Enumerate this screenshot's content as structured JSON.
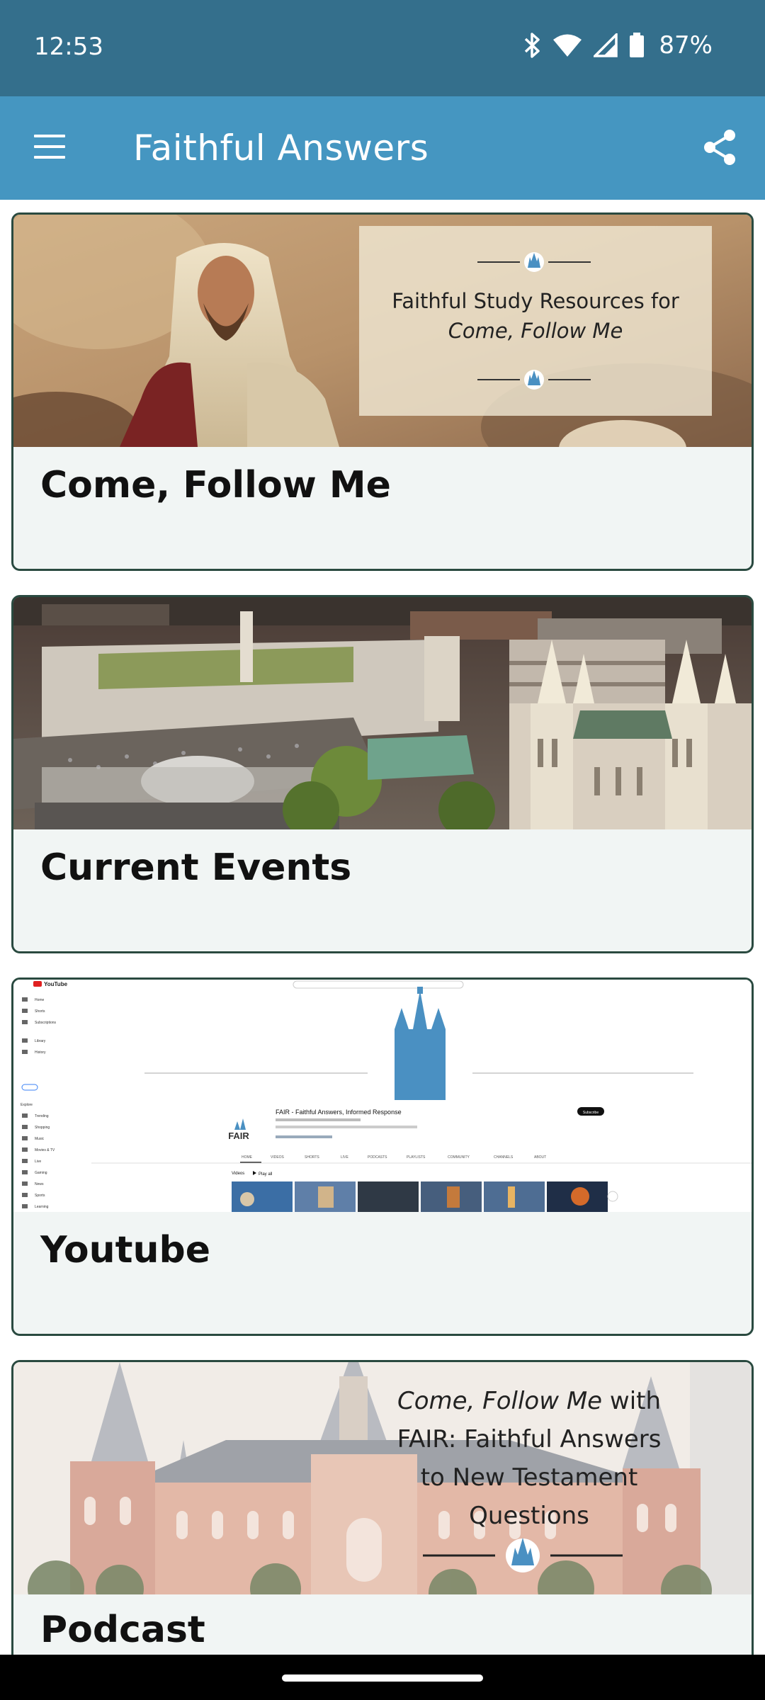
{
  "status_bar": {
    "time": "12:53",
    "battery_percent": "87%",
    "icons": [
      "bluetooth-icon",
      "wifi-icon",
      "signal-icon",
      "battery-icon"
    ]
  },
  "app_bar": {
    "title": "Faithful Answers",
    "menu_icon": "menu-icon",
    "share_icon": "share-icon"
  },
  "cards": [
    {
      "title": "Come, Follow Me",
      "image_overlay": {
        "line1": "Faithful Study Resources for",
        "line2": "Come, Follow Me"
      }
    },
    {
      "title": "Current Events"
    },
    {
      "title": "Youtube",
      "screenshot": {
        "site": "YouTube",
        "channel_name": "FAIR - Faithful Answers, Informed Response",
        "channel_logo_text": "FAIR",
        "subscribe": "Subscribe",
        "tabs": [
          "HOME",
          "VIDEOS",
          "SHORTS",
          "LIVE",
          "PODCASTS",
          "PLAYLISTS",
          "COMMUNITY",
          "CHANNELS",
          "ABOUT"
        ],
        "sidebar": [
          "Home",
          "Shorts",
          "Subscriptions",
          "Library",
          "History",
          "Explore",
          "Trending",
          "Shopping",
          "Music",
          "Movies & TV",
          "Live",
          "Gaming",
          "News",
          "Sports",
          "Learning"
        ],
        "section": "Videos",
        "play_all": "Play all"
      }
    },
    {
      "title": "Podcast",
      "image_overlay": {
        "line1a": "Come, Follow Me",
        "line1b": " with",
        "line2": "FAIR: Faithful Answers",
        "line3": "to New Testament",
        "line4": "Questions"
      }
    }
  ],
  "colors": {
    "status_bar": "#346f8c",
    "app_bar": "#4596c1",
    "card_background": "#f1f5f4",
    "card_border": "#2a4a40",
    "accent_blue": "#4a90c2"
  }
}
